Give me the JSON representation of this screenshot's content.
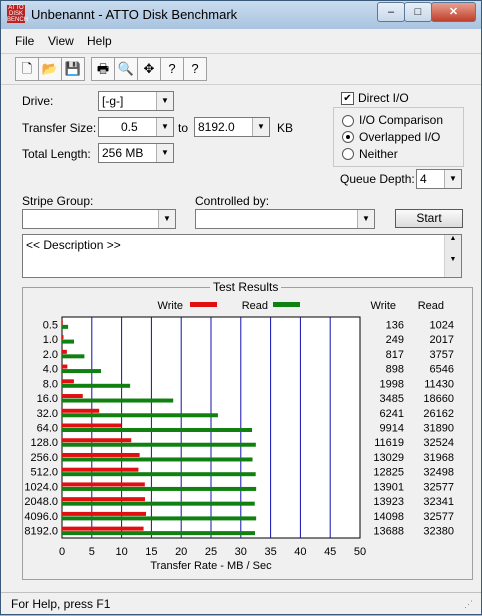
{
  "window": {
    "title": "Unbenannt - ATTO Disk Benchmark",
    "app_icon_text": "ATTO DISK BENCH",
    "min": "–",
    "max": "□",
    "close": "✕"
  },
  "menu": [
    "File",
    "View",
    "Help"
  ],
  "toolbar_icons": [
    "new-icon",
    "open-icon",
    "save-icon",
    "print-icon",
    "print-preview-icon",
    "move-icon",
    "help-icon",
    "context-help-icon"
  ],
  "form": {
    "drive_label": "Drive:",
    "drive_value": "[-g-]",
    "transfer_size_label": "Transfer Size:",
    "transfer_from": "0.5",
    "transfer_to_label": "to",
    "transfer_to": "8192.0",
    "transfer_unit": "KB",
    "total_length_label": "Total Length:",
    "total_length_value": "256 MB",
    "direct_io_label": "Direct I/O",
    "direct_io_checked": true,
    "io_options": [
      "I/O Comparison",
      "Overlapped I/O",
      "Neither"
    ],
    "io_selected": "Overlapped I/O",
    "queue_depth_label": "Queue Depth:",
    "queue_depth_value": "4",
    "stripe_group_label": "Stripe Group:",
    "controlled_by_label": "Controlled by:",
    "start_label": "Start",
    "description_text": "<< Description >>"
  },
  "results_title": "Test Results",
  "status": "For Help, press F1",
  "chart_data": {
    "type": "bar",
    "orientation": "horizontal",
    "xlabel": "Transfer Rate - MB / Sec",
    "xlim": [
      0,
      50
    ],
    "xticks": [
      0,
      5,
      10,
      15,
      20,
      25,
      30,
      35,
      40,
      45,
      50
    ],
    "categories": [
      "0.5",
      "1.0",
      "2.0",
      "4.0",
      "8.0",
      "16.0",
      "32.0",
      "64.0",
      "128.0",
      "256.0",
      "512.0",
      "1024.0",
      "2048.0",
      "4096.0",
      "8192.0"
    ],
    "series": [
      {
        "name": "Write",
        "color": "#e01010",
        "values": [
          136,
          249,
          817,
          898,
          1998,
          3485,
          6241,
          9914,
          11619,
          13029,
          12825,
          13901,
          13923,
          14098,
          13688
        ]
      },
      {
        "name": "Read",
        "color": "#108010",
        "values": [
          1024,
          2017,
          3757,
          6546,
          11430,
          18660,
          26162,
          31890,
          32524,
          31968,
          32498,
          32577,
          32341,
          32577,
          32380
        ]
      }
    ],
    "value_columns": [
      "Write",
      "Read"
    ],
    "value_to_mbps_divisor": 1000,
    "grid": true,
    "legend_position": "top"
  }
}
